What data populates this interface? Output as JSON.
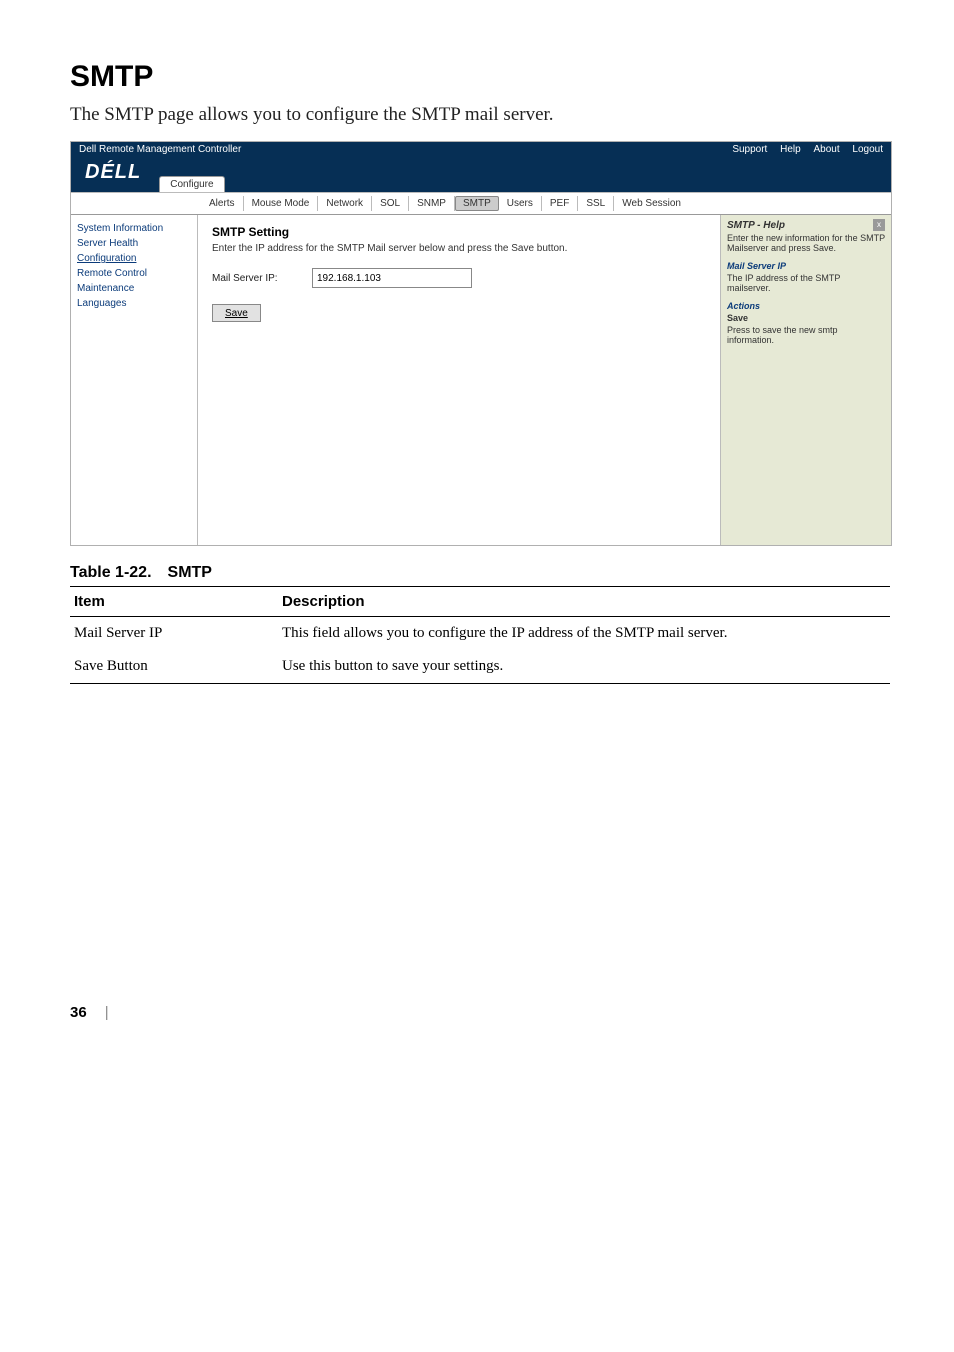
{
  "section": {
    "title": "SMTP",
    "intro": "The SMTP page allows you to configure the SMTP mail server."
  },
  "app": {
    "windowTitle": "Dell Remote Management Controller",
    "topLinks": {
      "support": "Support",
      "help": "Help",
      "about": "About",
      "logout": "Logout"
    },
    "brand": "DÉLL",
    "topTabs": {
      "configure": "Configure"
    },
    "subTabs": {
      "alerts": "Alerts",
      "mouseMode": "Mouse Mode",
      "network": "Network",
      "sol": "SOL",
      "snmp": "SNMP",
      "smtp": "SMTP",
      "users": "Users",
      "pef": "PEF",
      "ssl": "SSL",
      "webSession": "Web Session"
    },
    "sidebar": {
      "systemInformation": "System Information",
      "serverHealth": "Server Health",
      "configuration": "Configuration",
      "remoteControl": "Remote Control",
      "maintenance": "Maintenance",
      "languages": "Languages"
    },
    "main": {
      "heading": "SMTP Setting",
      "description": "Enter the IP address for the SMTP Mail server below and press the Save button.",
      "fieldLabel": "Mail Server IP:",
      "fieldValue": "192.168.1.103",
      "saveLabel": "Save"
    },
    "help": {
      "title": "SMTP - Help",
      "intro": "Enter the new information for the SMTP Mailserver and press Save.",
      "mailServerHead": "Mail Server IP",
      "mailServerText": "The IP address of the SMTP mailserver.",
      "actionsHead": "Actions",
      "saveHead": "Save",
      "saveText": "Press to save the new smtp information."
    }
  },
  "table": {
    "caption": "Table 1-22. SMTP",
    "headItem": "Item",
    "headDesc": "Description",
    "rows": [
      {
        "item": "Mail Server IP",
        "desc": "This field allows you to configure the IP address of the SMTP mail server."
      },
      {
        "item": "Save Button",
        "desc": "Use this button to save your settings."
      }
    ]
  },
  "pageNumber": "36"
}
